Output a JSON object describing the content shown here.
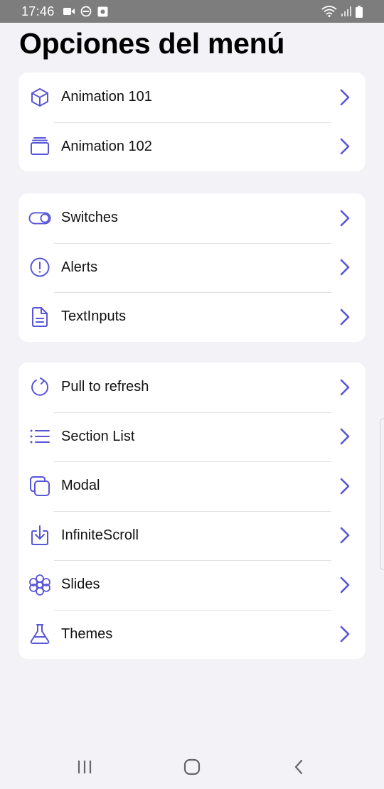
{
  "status_bar": {
    "time": "17:46",
    "left_icons": [
      "video-camera-icon",
      "do-not-disturb-icon",
      "notification-app-icon"
    ],
    "right_icons": [
      "wifi-icon",
      "cell-signal-icon",
      "battery-icon"
    ]
  },
  "title": "Opciones del menú",
  "accent_color": "#5856d6",
  "groups": [
    {
      "items": [
        {
          "label": "Animation 101",
          "icon": "cube-icon"
        },
        {
          "label": "Animation 102",
          "icon": "albums-icon"
        }
      ]
    },
    {
      "items": [
        {
          "label": "Switches",
          "icon": "toggle-icon"
        },
        {
          "label": "Alerts",
          "icon": "alert-circle-icon"
        },
        {
          "label": "TextInputs",
          "icon": "document-text-icon"
        }
      ]
    },
    {
      "items": [
        {
          "label": "Pull to refresh",
          "icon": "refresh-icon"
        },
        {
          "label": "Section List",
          "icon": "list-icon"
        },
        {
          "label": "Modal",
          "icon": "copy-icon"
        },
        {
          "label": "InfiniteScroll",
          "icon": "download-icon"
        },
        {
          "label": "Slides",
          "icon": "flower-icon"
        },
        {
          "label": "Themes",
          "icon": "flask-icon"
        }
      ]
    }
  ],
  "nav_bar": [
    "recent-apps-icon",
    "home-icon",
    "back-icon"
  ]
}
